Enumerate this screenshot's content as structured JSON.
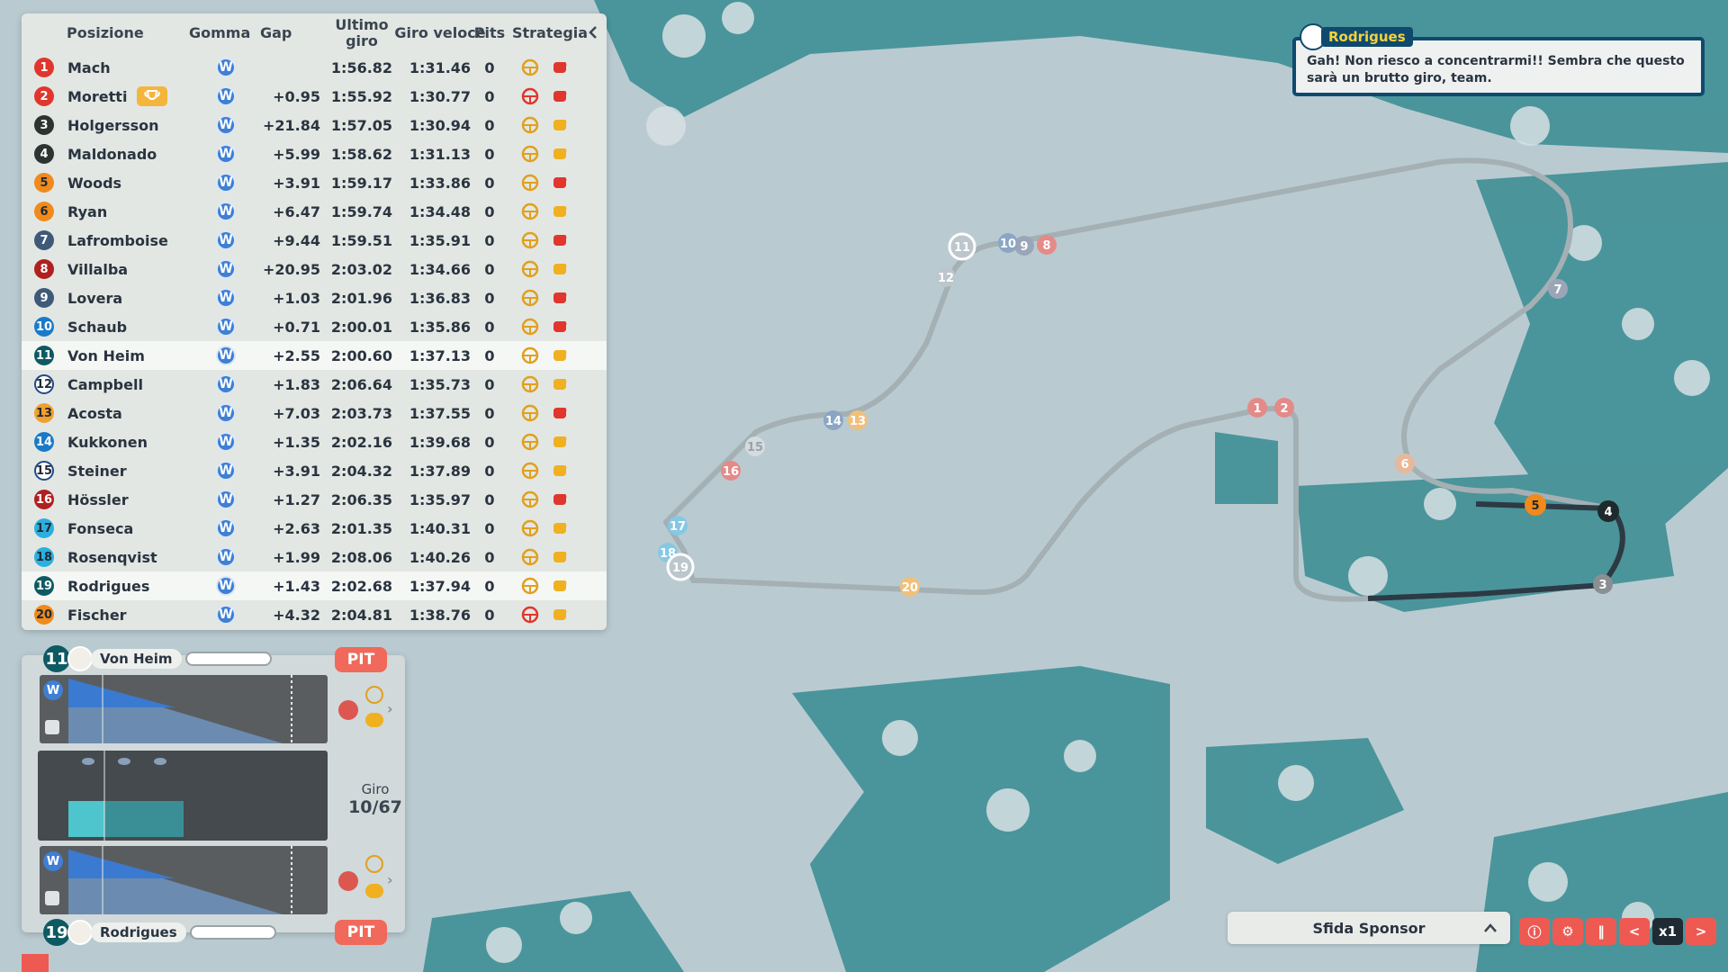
{
  "standings": {
    "headers": {
      "position": "Posizione",
      "tyre": "Gomma",
      "gap": "Gap",
      "last_lap": "Ultimo giro",
      "fastest_lap": "Giro veloce",
      "pits": "Pits",
      "strategy": "Strategia"
    },
    "rows": [
      {
        "pos": "1",
        "name": "Mach",
        "tyre": "W",
        "gap": "",
        "last": "1:56.82",
        "fast": "1:31.46",
        "pits": "0",
        "color": "#e0362e",
        "s1": "neutral",
        "s2": "red"
      },
      {
        "pos": "2",
        "name": "Moretti",
        "tyre": "W",
        "gap": "+0.95",
        "last": "1:55.92",
        "fast": "1:30.77",
        "pits": "0",
        "color": "#e0362e",
        "s1": "red",
        "s2": "red",
        "trophy": true
      },
      {
        "pos": "3",
        "name": "Holgersson",
        "tyre": "W",
        "gap": "+21.84",
        "last": "1:57.05",
        "fast": "1:30.94",
        "pits": "0",
        "color": "#2c3330",
        "s1": "neutral",
        "s2": "yellow"
      },
      {
        "pos": "4",
        "name": "Maldonado",
        "tyre": "W",
        "gap": "+5.99",
        "last": "1:58.62",
        "fast": "1:31.13",
        "pits": "0",
        "color": "#2c3330",
        "s1": "neutral",
        "s2": "yellow"
      },
      {
        "pos": "5",
        "name": "Woods",
        "tyre": "W",
        "gap": "+3.91",
        "last": "1:59.17",
        "fast": "1:33.86",
        "pits": "0",
        "color": "#f08a1c",
        "s1": "neutral",
        "s2": "red"
      },
      {
        "pos": "6",
        "name": "Ryan",
        "tyre": "W",
        "gap": "+6.47",
        "last": "1:59.74",
        "fast": "1:34.48",
        "pits": "0",
        "color": "#f08a1c",
        "s1": "neutral",
        "s2": "yellow"
      },
      {
        "pos": "7",
        "name": "Lafromboise",
        "tyre": "W",
        "gap": "+9.44",
        "last": "1:59.51",
        "fast": "1:35.91",
        "pits": "0",
        "color": "#3e5a78",
        "s1": "neutral",
        "s2": "red"
      },
      {
        "pos": "8",
        "name": "Villalba",
        "tyre": "W",
        "gap": "+20.95",
        "last": "2:03.02",
        "fast": "1:34.66",
        "pits": "0",
        "color": "#b02020",
        "s1": "neutral",
        "s2": "yellow"
      },
      {
        "pos": "9",
        "name": "Lovera",
        "tyre": "W",
        "gap": "+1.03",
        "last": "2:01.96",
        "fast": "1:36.83",
        "pits": "0",
        "color": "#3e5a78",
        "s1": "neutral",
        "s2": "red"
      },
      {
        "pos": "10",
        "name": "Schaub",
        "tyre": "W",
        "gap": "+0.71",
        "last": "2:00.01",
        "fast": "1:35.86",
        "pits": "0",
        "color": "#1a7ac8",
        "s1": "neutral",
        "s2": "red"
      },
      {
        "pos": "11",
        "name": "Von Heim",
        "tyre": "W",
        "gap": "+2.55",
        "last": "2:00.60",
        "fast": "1:37.13",
        "pits": "0",
        "color": "#0d5a62",
        "s1": "neutral",
        "s2": "yellow",
        "highlight": true
      },
      {
        "pos": "12",
        "name": "Campbell",
        "tyre": "W",
        "gap": "+1.83",
        "last": "2:06.64",
        "fast": "1:35.73",
        "pits": "0",
        "color": "#ffffff",
        "s1": "neutral",
        "s2": "yellow"
      },
      {
        "pos": "13",
        "name": "Acosta",
        "tyre": "W",
        "gap": "+7.03",
        "last": "2:03.73",
        "fast": "1:37.55",
        "pits": "0",
        "color": "#f0a030",
        "s1": "neutral",
        "s2": "red"
      },
      {
        "pos": "14",
        "name": "Kukkonen",
        "tyre": "W",
        "gap": "+1.35",
        "last": "2:02.16",
        "fast": "1:39.68",
        "pits": "0",
        "color": "#1a7ac8",
        "s1": "neutral",
        "s2": "yellow"
      },
      {
        "pos": "15",
        "name": "Steiner",
        "tyre": "W",
        "gap": "+3.91",
        "last": "2:04.32",
        "fast": "1:37.89",
        "pits": "0",
        "color": "#ffffff",
        "s1": "neutral",
        "s2": "yellow"
      },
      {
        "pos": "16",
        "name": "Hössler",
        "tyre": "W",
        "gap": "+1.27",
        "last": "2:06.35",
        "fast": "1:35.97",
        "pits": "0",
        "color": "#b02020",
        "s1": "neutral",
        "s2": "red"
      },
      {
        "pos": "17",
        "name": "Fonseca",
        "tyre": "W",
        "gap": "+2.63",
        "last": "2:01.35",
        "fast": "1:40.31",
        "pits": "0",
        "color": "#2ab0e0",
        "s1": "neutral",
        "s2": "yellow"
      },
      {
        "pos": "18",
        "name": "Rosenqvist",
        "tyre": "W",
        "gap": "+1.99",
        "last": "2:08.06",
        "fast": "1:40.26",
        "pits": "0",
        "color": "#2ab0e0",
        "s1": "neutral",
        "s2": "yellow"
      },
      {
        "pos": "19",
        "name": "Rodrigues",
        "tyre": "W",
        "gap": "+1.43",
        "last": "2:02.68",
        "fast": "1:37.94",
        "pits": "0",
        "color": "#0d5a62",
        "s1": "neutral",
        "s2": "yellow",
        "highlight": true
      },
      {
        "pos": "20",
        "name": "Fischer",
        "tyre": "W",
        "gap": "+4.32",
        "last": "2:04.81",
        "fast": "1:38.76",
        "pits": "0",
        "color": "#f08a1c",
        "s1": "red",
        "s2": "yellow"
      }
    ]
  },
  "panel": {
    "driver1": {
      "num": "11",
      "name": "Von Heim",
      "pit": "PIT",
      "tyre": "W"
    },
    "driver2": {
      "num": "19",
      "name": "Rodrigues",
      "pit": "PIT",
      "tyre": "W"
    },
    "lap_label": "Giro",
    "lap_value": "10/67"
  },
  "chat": {
    "speaker": "Rodrigues",
    "message": "Gah! Non riesco a concentrarmi!! Sembra che questo sarà un brutto giro, team."
  },
  "sponsor": {
    "label": "Sfida Sponsor"
  },
  "controls": {
    "speed": "x1",
    "prev": "<",
    "next": ">"
  },
  "track_markers": [
    "1",
    "2",
    "3",
    "4",
    "5",
    "6",
    "7",
    "8",
    "9",
    "10",
    "11",
    "12",
    "13",
    "14",
    "15",
    "16",
    "17",
    "18",
    "19",
    "20"
  ],
  "colors": {
    "accent": "#ee5a52",
    "water": "#2b8a96",
    "panel_bg": "#e5e8e4",
    "chat_border": "#0f4a6e"
  }
}
